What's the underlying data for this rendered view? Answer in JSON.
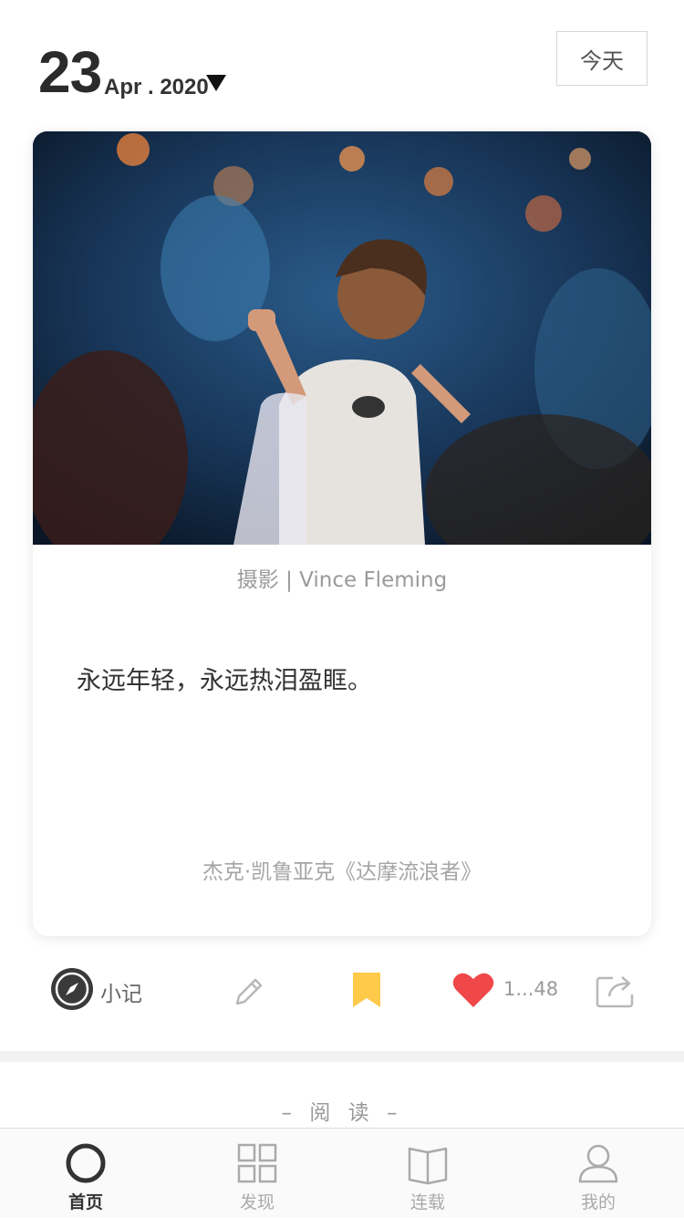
{
  "header": {
    "day": "23",
    "month_year": "Apr . 2020",
    "today_button": "今天"
  },
  "card": {
    "photo_credit": "摄影 | Vince Fleming",
    "quote": "永远年轻，永远热泪盈眶。",
    "source": "杰克·凯鲁亚克《达摩流浪者》"
  },
  "actions": {
    "note_label": "小记",
    "like_count": "1...48",
    "colors": {
      "bookmark": "#FFC94A",
      "heart": "#F0484A",
      "compass": "#3a3a3a"
    }
  },
  "section": {
    "read_title": "– 阅 读 –"
  },
  "tabbar": {
    "tabs": [
      {
        "label": "首页",
        "icon": "home-circle-icon",
        "active": true
      },
      {
        "label": "发现",
        "icon": "grid-icon",
        "active": false
      },
      {
        "label": "连载",
        "icon": "book-icon",
        "active": false
      },
      {
        "label": "我的",
        "icon": "user-icon",
        "active": false
      }
    ]
  }
}
